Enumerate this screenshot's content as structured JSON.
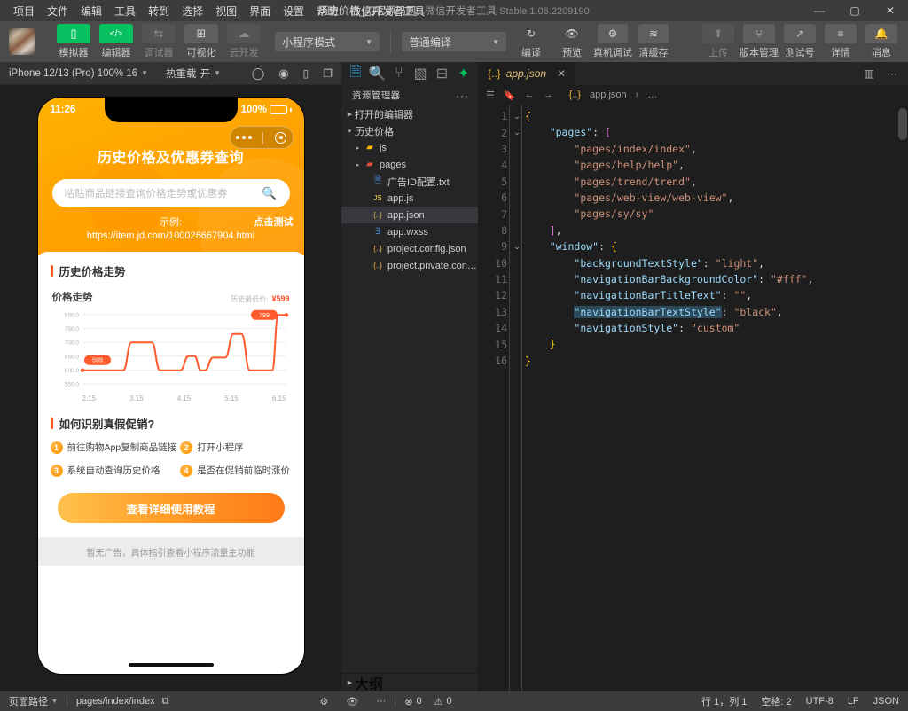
{
  "titlebar": {
    "menus": [
      "项目",
      "文件",
      "编辑",
      "工具",
      "转到",
      "选择",
      "视图",
      "界面",
      "设置",
      "帮助",
      "微信开发者工具"
    ],
    "project_title": "历史价格_刀客源码网",
    "dash": "-",
    "app_name": "微信开发者工具",
    "version": "Stable 1.06.2209190",
    "minimize": "—",
    "maximize": "▢",
    "close": "✕"
  },
  "toolbar": {
    "left_buttons": [
      {
        "label": "模拟器",
        "icon": "phone-icon",
        "glyph": "▯",
        "state": "active"
      },
      {
        "label": "编辑器",
        "icon": "code-icon",
        "glyph": "</>",
        "state": "active"
      },
      {
        "label": "调试器",
        "icon": "debugger-icon",
        "glyph": "⇆",
        "state": "dim"
      },
      {
        "label": "可视化",
        "icon": "layout-icon",
        "glyph": "⊞",
        "state": "normal"
      },
      {
        "label": "云开发",
        "icon": "cloud-icon",
        "glyph": "☁",
        "state": "dim"
      }
    ],
    "mode_select": "小程序模式",
    "compile_select": "普通编译",
    "action_buttons": [
      {
        "label": "编译",
        "icon": "refresh-icon",
        "glyph": "↻",
        "framed": false
      },
      {
        "label": "预览",
        "icon": "eye-icon",
        "glyph": "👁",
        "framed": false
      },
      {
        "label": "真机调试",
        "icon": "device-debug-icon",
        "glyph": "⚙",
        "framed": true
      },
      {
        "label": "清缓存",
        "icon": "layers-icon",
        "glyph": "≋",
        "framed": true
      }
    ],
    "right_buttons": [
      {
        "label": "上传",
        "icon": "upload-icon",
        "glyph": "⬆",
        "state": "dim"
      },
      {
        "label": "版本管理",
        "icon": "branch-icon",
        "glyph": "⑂",
        "state": "normal"
      },
      {
        "label": "测试号",
        "icon": "external-icon",
        "glyph": "↗",
        "state": "normal"
      },
      {
        "label": "详情",
        "icon": "menu-icon",
        "glyph": "≡",
        "state": "normal"
      },
      {
        "label": "消息",
        "icon": "bell-icon",
        "glyph": "🔔",
        "state": "normal"
      }
    ]
  },
  "simulator_bar": {
    "device": "iPhone 12/13 (Pro) 100% 16",
    "hotreload_label": "热重载",
    "hotreload_value": "开",
    "icons": [
      "refresh-circle-icon",
      "record-icon",
      "rotate-icon",
      "window-icon"
    ]
  },
  "phone": {
    "status_time": "11:26",
    "battery_percent": "100%",
    "page_title": "历史价格及优惠券查询",
    "search_placeholder": "粘贴商品链接查询价格走势或优惠券",
    "example_label": "示例:",
    "test_link": "点击测试",
    "example_url": "https://item.jd.com/100026667904.html",
    "trend_section_title": "历史价格走势",
    "chart_title": "价格走势",
    "lowest_label": "历史最低价:",
    "lowest_value": "¥599",
    "howto_title": "如何识别真假促销?",
    "steps": [
      {
        "num": "1",
        "text": "前往购物App复制商品链接"
      },
      {
        "num": "2",
        "text": "打开小程序"
      },
      {
        "num": "3",
        "text": "系统自动查询历史价格"
      },
      {
        "num": "4",
        "text": "是否在促销前临时涨价"
      }
    ],
    "cta": "查看详细使用教程",
    "ad_note": "暂无广告，具体指引查看小程序流量主功能"
  },
  "chart_data": {
    "type": "line",
    "title": "价格走势",
    "xlabel": "",
    "ylabel": "",
    "ylim": [
      550.0,
      800.0
    ],
    "yticks": [
      "800.0",
      "750.0",
      "700.0",
      "650.0",
      "600.0",
      "550.0"
    ],
    "xticks": [
      "2.15",
      "3.15",
      "4.15",
      "5.15",
      "6.15"
    ],
    "grid": true,
    "legend": false,
    "annotations": [
      {
        "label": "599",
        "value": 599,
        "position": "start",
        "color": "#ff5a2c"
      },
      {
        "label": "799",
        "value": 799,
        "position": "end",
        "color": "#ff5a2c"
      }
    ],
    "line_color": "#ff5a2c",
    "series": [
      {
        "name": "价格",
        "x": [
          0,
          5,
          12,
          18,
          20,
          24,
          27,
          29,
          34,
          38,
          41,
          45,
          48,
          52,
          55,
          58,
          60,
          64,
          67,
          70,
          74,
          78,
          82,
          86,
          90,
          93,
          96,
          100
        ],
        "values": [
          599,
          599,
          599,
          599,
          599,
          700,
          700,
          700,
          700,
          599,
          599,
          599,
          599,
          650,
          650,
          599,
          599,
          645,
          645,
          645,
          730,
          730,
          599,
          599,
          599,
          599,
          799,
          799
        ]
      }
    ]
  },
  "explorer": {
    "activity_icons": [
      "files-icon",
      "search-icon",
      "source-control-icon",
      "extensions-icon",
      "debug-icon",
      "wechat-icon"
    ],
    "header": "资源管理器",
    "more": "···",
    "sections": [
      {
        "label": "打开的编辑器",
        "expanded": false
      },
      {
        "label": "历史价格",
        "expanded": true
      }
    ],
    "files": [
      {
        "name": "js",
        "type": "folder",
        "icon": "folder-js-icon",
        "indent": 1,
        "arrow": "▸",
        "color": "#ffb300"
      },
      {
        "name": "pages",
        "type": "folder",
        "icon": "folder-pages-icon",
        "indent": 1,
        "arrow": "▸",
        "color": "#e8503a"
      },
      {
        "name": "广告ID配置.txt",
        "type": "file",
        "icon": "text-file-icon",
        "indent": 2,
        "arrow": "",
        "color": "#4a90d9"
      },
      {
        "name": "app.js",
        "type": "file",
        "icon": "js-file-icon",
        "indent": 2,
        "arrow": "",
        "color": "#f5d742"
      },
      {
        "name": "app.json",
        "type": "file",
        "icon": "json-file-icon",
        "indent": 2,
        "arrow": "",
        "color": "#e8b339",
        "selected": true
      },
      {
        "name": "app.wxss",
        "type": "file",
        "icon": "css-file-icon",
        "indent": 2,
        "arrow": "",
        "color": "#4a90d9"
      },
      {
        "name": "project.config.json",
        "type": "file",
        "icon": "json-file-icon",
        "indent": 2,
        "arrow": "",
        "color": "#e8b339"
      },
      {
        "name": "project.private.config.js...",
        "type": "file",
        "icon": "json-file-icon",
        "indent": 2,
        "arrow": "",
        "color": "#e8b339"
      }
    ],
    "outline_label": "大纲"
  },
  "editor": {
    "tab_name": "app.json",
    "tab_icon": "{..}",
    "tab_close": "✕",
    "split_icon": "▥",
    "more_icon": "···",
    "breadcrumb_icons": [
      "list-icon",
      "bookmark-icon",
      "back-arrow-icon",
      "forward-arrow-icon"
    ],
    "breadcrumb_file": "app.json",
    "breadcrumb_sep": "›",
    "breadcrumb_tail": "…",
    "lines": [
      {
        "n": "1",
        "fold": "⌄",
        "html": "<span class='br'>{</span>"
      },
      {
        "n": "2",
        "fold": "⌄",
        "html": "    <span class='k'>\"pages\"</span><span class='p'>:</span> <span class='brm'>[</span>"
      },
      {
        "n": "3",
        "fold": "",
        "html": "        <span class='s'>\"pages/index/index\"</span><span class='p'>,</span>"
      },
      {
        "n": "4",
        "fold": "",
        "html": "        <span class='s'>\"pages/help/help\"</span><span class='p'>,</span>"
      },
      {
        "n": "5",
        "fold": "",
        "html": "        <span class='s'>\"pages/trend/trend\"</span><span class='p'>,</span>"
      },
      {
        "n": "6",
        "fold": "",
        "html": "        <span class='s'>\"pages/web-view/web-view\"</span><span class='p'>,</span>"
      },
      {
        "n": "7",
        "fold": "",
        "html": "        <span class='s'>\"pages/sy/sy\"</span>"
      },
      {
        "n": "8",
        "fold": "",
        "html": "    <span class='brm'>]</span><span class='p'>,</span>"
      },
      {
        "n": "9",
        "fold": "⌄",
        "html": "    <span class='k'>\"window\"</span><span class='p'>:</span> <span class='br'>{</span>"
      },
      {
        "n": "10",
        "fold": "",
        "html": "        <span class='k'>\"backgroundTextStyle\"</span><span class='p'>:</span> <span class='s'>\"light\"</span><span class='p'>,</span>"
      },
      {
        "n": "11",
        "fold": "",
        "html": "        <span class='k'>\"navigationBarBackgroundColor\"</span><span class='p'>:</span> <span class='s'>\"#fff\"</span><span class='p'>,</span>"
      },
      {
        "n": "12",
        "fold": "",
        "html": "        <span class='k'>\"navigationBarTitleText\"</span><span class='p'>:</span> <span class='s'>\"\"</span><span class='p'>,</span>"
      },
      {
        "n": "13",
        "fold": "",
        "html": "        <span class='k sel-word'>\"navigationBarTextStyle\"</span><span class='p'>:</span> <span class='s'>\"black\"</span><span class='p'>,</span>"
      },
      {
        "n": "14",
        "fold": "",
        "html": "        <span class='k'>\"navigationStyle\"</span><span class='p'>:</span> <span class='s'>\"custom\"</span>"
      },
      {
        "n": "15",
        "fold": "",
        "html": "    <span class='br'>}</span>"
      },
      {
        "n": "16",
        "fold": "",
        "html": "<span class='br'>}</span>"
      }
    ]
  },
  "status_bar": {
    "path_label": "页面路径",
    "path_value": "pages/index/index",
    "copy_icon": "copy-icon",
    "mid_icons": [
      "bug-icon",
      "eye-icon",
      "more-icon"
    ],
    "errors": "0",
    "warnings": "0",
    "error_icon": "⊗",
    "warning_icon": "⚠",
    "cursor": "行 1，列 1",
    "spaces": "空格: 2",
    "encoding": "UTF-8",
    "eol": "LF",
    "language": "JSON"
  }
}
